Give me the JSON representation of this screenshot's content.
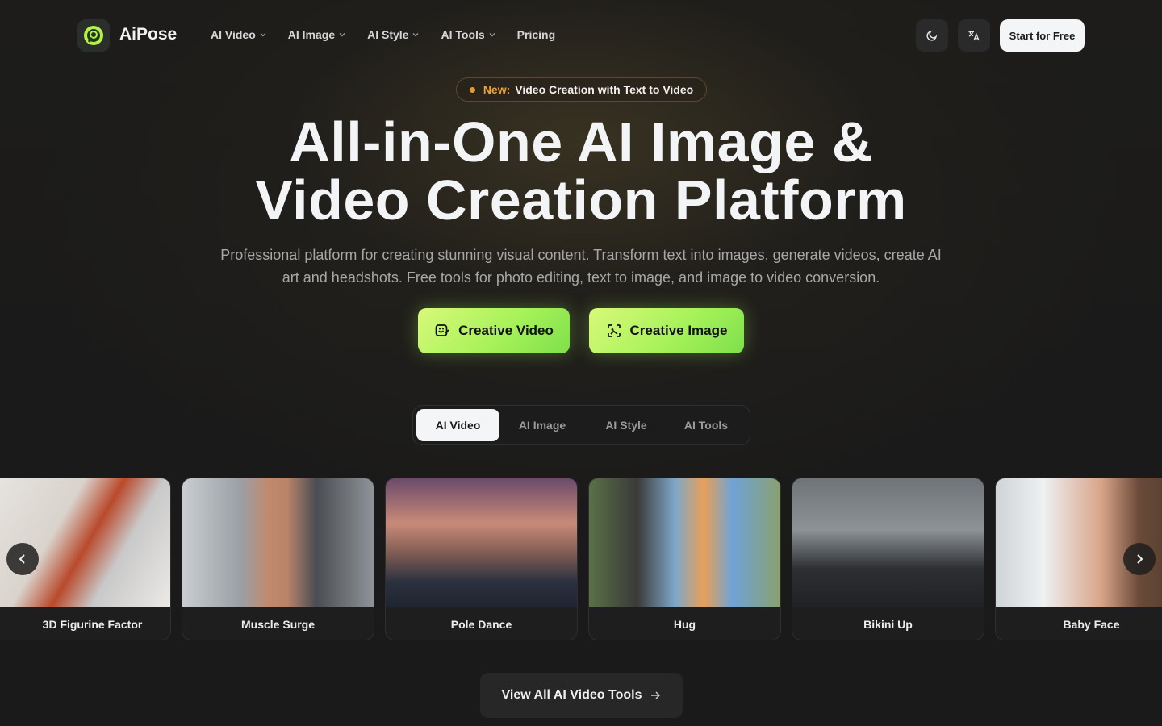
{
  "brand": {
    "name": "AiPose",
    "accent": "#a8f25a"
  },
  "nav": {
    "links": [
      {
        "label": "AI Video",
        "dropdown": true
      },
      {
        "label": "AI Image",
        "dropdown": true
      },
      {
        "label": "AI Style",
        "dropdown": true
      },
      {
        "label": "AI Tools",
        "dropdown": true
      },
      {
        "label": "Pricing",
        "dropdown": false
      }
    ],
    "theme_icon": "moon-icon",
    "language_icon": "translate-icon",
    "start_label": "Start for Free"
  },
  "hero": {
    "badge_new": "New:",
    "badge_text": "Video Creation with Text to Video",
    "headline_1": "All-in-One AI Image &",
    "headline_2": "Video Creation Platform",
    "subtitle": "Professional platform for creating stunning visual content. Transform text into images, generate videos, create AI art and headshots. Free tools for photo editing, text to image, and image to video conversion.",
    "cta_video": "Creative Video",
    "cta_image": "Creative Image"
  },
  "tabs": [
    "AI Video",
    "AI Image",
    "AI Style",
    "AI Tools"
  ],
  "active_tab": "AI Video",
  "cards": [
    {
      "title": "3D Figurine Factor"
    },
    {
      "title": "Muscle Surge"
    },
    {
      "title": "Pole Dance"
    },
    {
      "title": "Hug"
    },
    {
      "title": "Bikini Up"
    },
    {
      "title": "Baby Face"
    }
  ],
  "view_all": "View All AI Video Tools"
}
